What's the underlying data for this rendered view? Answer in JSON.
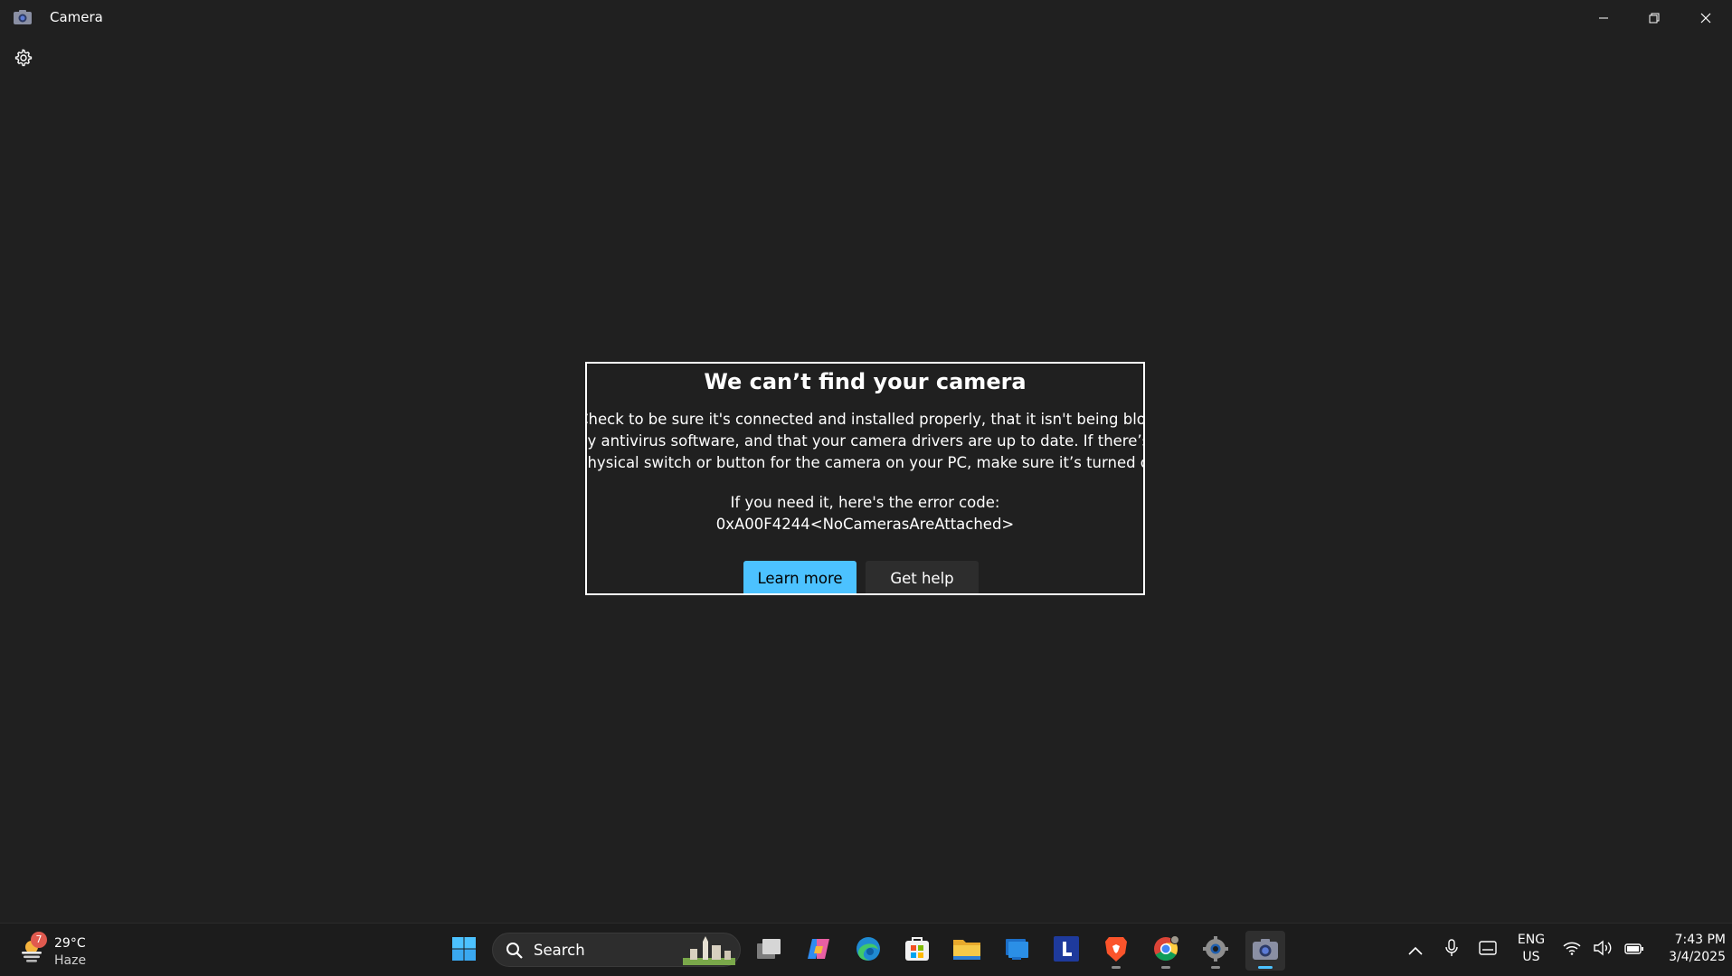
{
  "window": {
    "title": "Camera",
    "app_icon": "camera-icon",
    "controls": [
      "minimize-icon",
      "restore-icon",
      "close-icon"
    ]
  },
  "toolbar": {
    "settings_icon": "gear-icon"
  },
  "error_dialog": {
    "title": "We can’t find your camera",
    "body_lines": [
      "Check to be sure it's connected and installed properly, that it isn't being blocked",
      "by antivirus software, and that your camera drivers are up to date. If there’s a",
      "physical switch or button for the camera on your PC, make sure it’s turned on."
    ],
    "error_intro": "If you need it, here's the error code:",
    "error_code": "0xA00F4244<NoCamerasAreAttached>",
    "learn_more_label": "Learn more",
    "get_help_label": "Get help",
    "accent_color": "#4cc2ff"
  },
  "taskbar": {
    "weather": {
      "badge": "7",
      "temperature": "29°C",
      "condition": "Haze",
      "icon": "haze-weather-icon"
    },
    "search_placeholder": "Search",
    "pinned_apps": [
      {
        "name": "start-icon"
      },
      {
        "name": "task-view-icon"
      },
      {
        "name": "copilot-icon"
      },
      {
        "name": "edge-icon"
      },
      {
        "name": "microsoft-store-icon"
      },
      {
        "name": "file-explorer-icon"
      },
      {
        "name": "widgets-app-icon"
      },
      {
        "name": "l-app-icon"
      },
      {
        "name": "brave-browser-icon"
      },
      {
        "name": "chrome-icon"
      },
      {
        "name": "settings-app-icon"
      },
      {
        "name": "camera-app-icon"
      }
    ],
    "tray": {
      "icons": [
        "show-hidden-icons-chevron",
        "microphone-icon",
        "touch-keyboard-icon",
        "wifi-icon",
        "volume-icon",
        "battery-icon"
      ],
      "language_line1": "ENG",
      "language_line2": "US",
      "time": "7:43 PM",
      "date": "3/4/2025"
    }
  }
}
